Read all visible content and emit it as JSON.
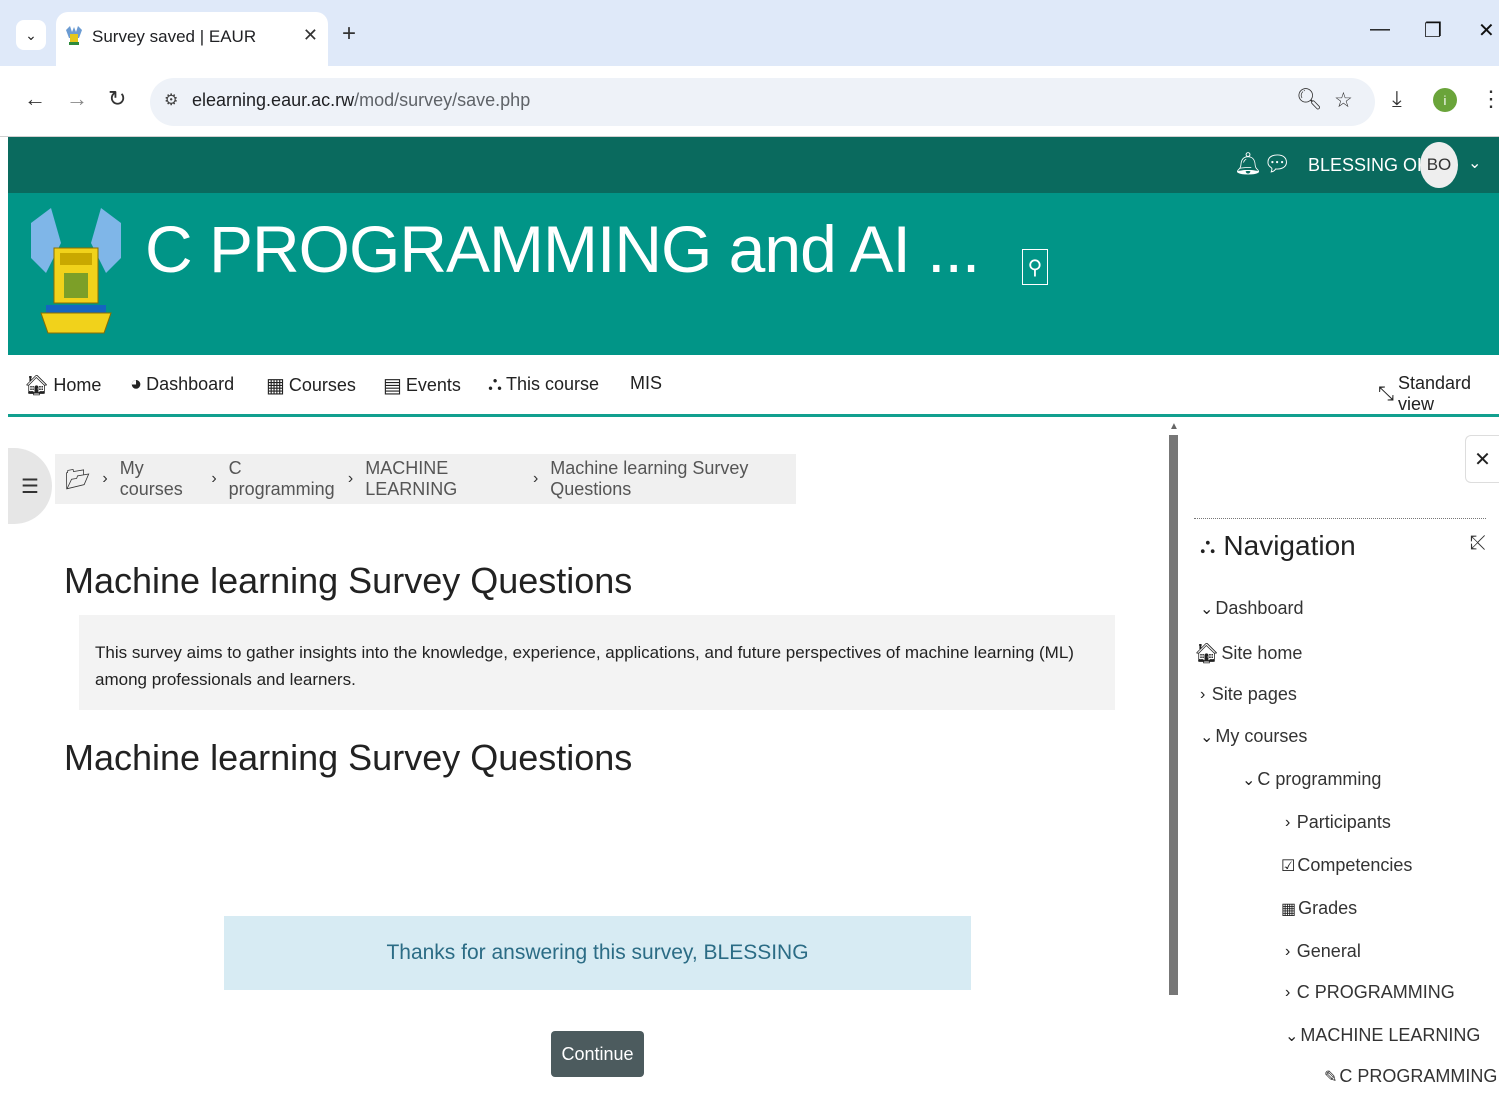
{
  "browser": {
    "tab_title": "Survey saved | EAUR",
    "url_host": "elearning.eaur.ac.rw",
    "url_path": "/mod/survey/save.php",
    "profile_initial": "i"
  },
  "topbar": {
    "username": "BLESSING OKIKI",
    "avatar_initials": "BO"
  },
  "banner": {
    "site_title": "C PROGRAMMING and AI ..."
  },
  "mainnav": {
    "items": [
      "Home",
      "Dashboard",
      "Courses",
      "Events",
      "This course",
      "MIS"
    ],
    "standard_view": "Standard view"
  },
  "breadcrumb": {
    "items": [
      "My courses",
      "C programming",
      "MACHINE LEARNING",
      "Machine learning Survey Questions"
    ]
  },
  "main": {
    "page_title": "Machine learning Survey Questions",
    "intro": "This survey aims to gather insights into the knowledge, experience, applications, and future perspectives of machine learning (ML) among professionals and learners.",
    "section_title": "Machine learning Survey Questions",
    "notice": "Thanks for answering this survey, BLESSING",
    "continue_label": "Continue"
  },
  "navigation_block": {
    "heading": "Navigation",
    "items": [
      "Dashboard",
      "Site home",
      "Site pages",
      "My courses",
      "C programming",
      "Participants",
      "Competencies",
      "Grades",
      "General",
      "C PROGRAMMING",
      "MACHINE LEARNING",
      "C PROGRAMMING"
    ]
  },
  "colors": {
    "topbar": "#0a6a5e",
    "banner": "#019587",
    "notice_bg": "#d7ebf3",
    "continue_bg": "#4c5b5e"
  }
}
